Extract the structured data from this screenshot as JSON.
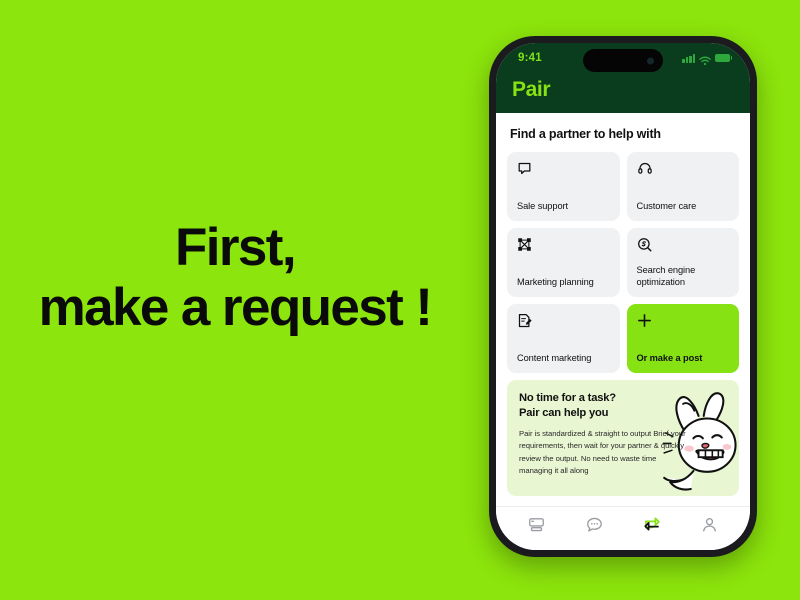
{
  "slide": {
    "background_color": "#8CE50C",
    "headline_line1": "First,",
    "headline_line2": "make a request !"
  },
  "phone": {
    "status_bar": {
      "time": "9:41",
      "signal_icon": "cellular-signal-icon",
      "wifi_icon": "wifi-icon",
      "battery_icon": "battery-icon",
      "icon_color": "#2EA83C"
    },
    "app_bar": {
      "brand": "Pair",
      "brand_color": "#86E213",
      "background_color": "#0A3D1E"
    },
    "content": {
      "section_title": "Find a partner to help with",
      "cards": [
        {
          "label": "Sale support",
          "icon": "speech-bubble-icon",
          "accent": false
        },
        {
          "label": "Customer care",
          "icon": "headset-icon",
          "accent": false
        },
        {
          "label": "Marketing planning",
          "icon": "network-nodes-icon",
          "accent": false
        },
        {
          "label": "Search engine optimization",
          "icon": "search-circle-icon",
          "accent": false
        },
        {
          "label": "Content marketing",
          "icon": "document-edit-icon",
          "accent": false
        },
        {
          "label": "Or make a post",
          "icon": "plus-icon",
          "accent": true
        }
      ],
      "promo": {
        "title_line1": "No time for a task?",
        "title_line2": "Pair can help you",
        "body": "Pair is standardized & straight to output Brief your requirements, then wait for your partner & quickly review the output. No need to waste time managing it all along",
        "background_color": "#E9F6D2",
        "mascot": "bunny-mascot-illustration"
      }
    },
    "bottom_nav": {
      "items": [
        {
          "name": "dashboard",
          "icon": "browser-window-icon",
          "active": false
        },
        {
          "name": "messages",
          "icon": "chat-bubble-icon",
          "active": false
        },
        {
          "name": "exchange",
          "icon": "swap-arrows-icon",
          "active": true
        },
        {
          "name": "profile",
          "icon": "user-avatar-icon",
          "active": false
        }
      ],
      "active_color": "#86E213"
    }
  }
}
